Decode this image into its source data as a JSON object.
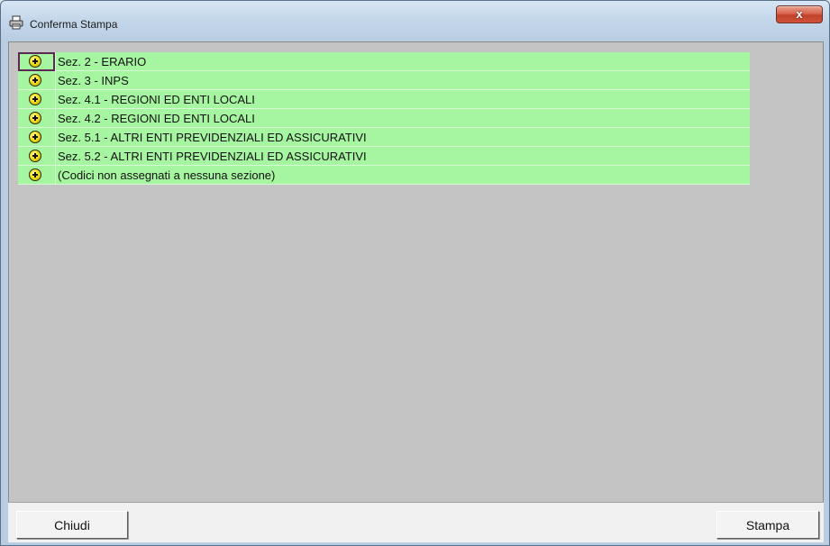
{
  "window": {
    "title": "Conferma Stampa",
    "close_label": "x"
  },
  "list": {
    "items": [
      {
        "label": "Sez. 2 - ERARIO",
        "focused": true
      },
      {
        "label": "Sez. 3 - INPS"
      },
      {
        "label": "Sez. 4.1 - REGIONI ED ENTI LOCALI"
      },
      {
        "label": "Sez. 4.2 - REGIONI ED ENTI LOCALI"
      },
      {
        "label": "Sez. 5.1 - ALTRI ENTI PREVIDENZIALI ED ASSICURATIVI"
      },
      {
        "label": "Sez. 5.2 - ALTRI ENTI PREVIDENZIALI ED ASSICURATIVI"
      },
      {
        "label": "(Codici non assegnati a nessuna sezione)"
      }
    ],
    "row_color": "#a6f5a0"
  },
  "footer": {
    "close_button": "Chiudi",
    "print_button": "Stampa"
  }
}
